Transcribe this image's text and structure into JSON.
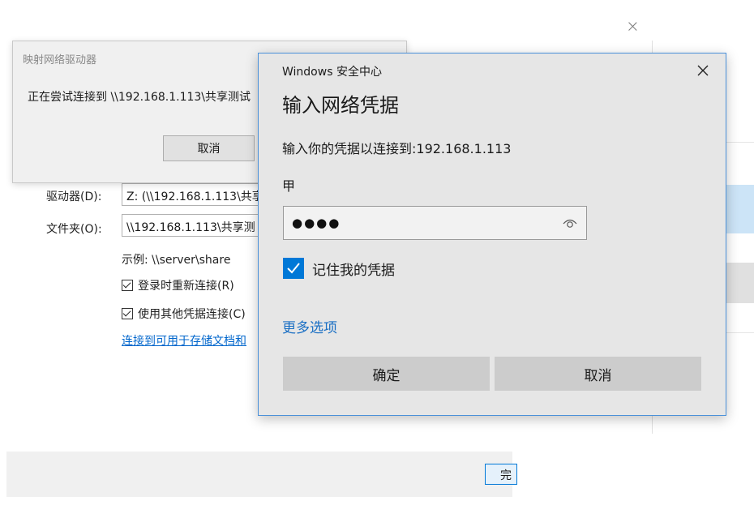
{
  "wizard": {
    "drive_label": "驱动器(D):",
    "drive_value": "Z: (\\\\192.168.1.113\\共享",
    "folder_label": "文件夹(O):",
    "folder_value": "\\\\192.168.1.113\\共享测",
    "example": "示例: \\\\server\\share",
    "reconnect_label": "登录时重新连接(R)",
    "other_creds_label": "使用其他凭据连接(C)",
    "link_text": "连接到可用于存储文档和",
    "finish_label": "完",
    "close_glyph": "×"
  },
  "progress": {
    "title": "映射网络驱动器",
    "message": "正在尝试连接到 \\\\192.168.1.113\\共享测试",
    "cancel_label": "取消"
  },
  "security": {
    "app_title": "Windows 安全中心",
    "heading": "输入网络凭据",
    "subtext": "输入你的凭据以连接到:192.168.1.113",
    "username": "甲",
    "password_mask": "●●●●",
    "remember_label": "记住我的凭据",
    "remember_checked": true,
    "more_options": "更多选项",
    "ok_label": "确定",
    "cancel_label": "取消"
  },
  "colors": {
    "accent": "#0078d7",
    "link": "#1a6fc4",
    "dialog_bg": "#e6e6e6",
    "button_bg": "#cccccc"
  }
}
